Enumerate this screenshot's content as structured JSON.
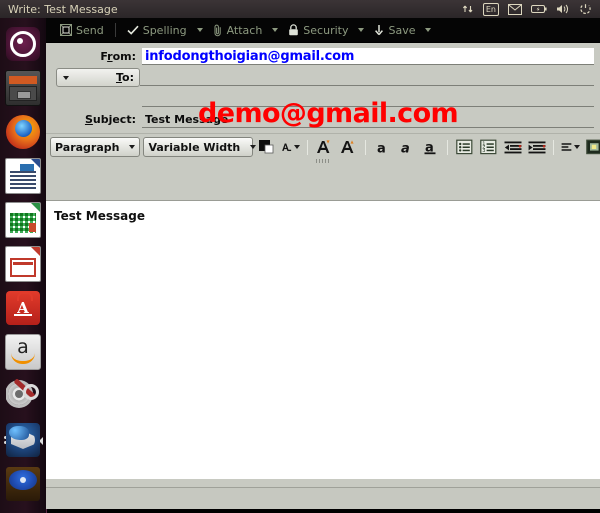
{
  "panel": {
    "title": "Write: Test Message",
    "indicators": [
      {
        "name": "network-icon",
        "label": "⇅"
      },
      {
        "name": "keyboard-layout-indicator",
        "label": "En"
      },
      {
        "name": "messaging-icon",
        "label": "✉"
      },
      {
        "name": "battery-icon",
        "label": ""
      },
      {
        "name": "volume-icon",
        "label": ""
      },
      {
        "name": "session-power-icon",
        "label": ""
      }
    ]
  },
  "launcher": {
    "items": [
      {
        "name": "launcher-ubuntu-dash",
        "label": "Dash home"
      },
      {
        "name": "launcher-files",
        "label": "Files"
      },
      {
        "name": "launcher-firefox",
        "label": "Firefox Web Browser"
      },
      {
        "name": "launcher-libreoffice-writer",
        "label": "LibreOffice Writer"
      },
      {
        "name": "launcher-libreoffice-calc",
        "label": "LibreOffice Calc"
      },
      {
        "name": "launcher-libreoffice-impress",
        "label": "LibreOffice Impress"
      },
      {
        "name": "launcher-software-center",
        "label": "Ubuntu Software Center"
      },
      {
        "name": "launcher-amazon",
        "label": "Amazon"
      },
      {
        "name": "launcher-system-settings",
        "label": "System Settings"
      },
      {
        "name": "launcher-thunderbird",
        "label": "Thunderbird Mail"
      },
      {
        "name": "launcher-media",
        "label": "Media player"
      }
    ]
  },
  "toolbar": {
    "send_label": "Send",
    "spelling_label": "Spelling",
    "attach_label": "Attach",
    "security_label": "Security",
    "save_label": "Save"
  },
  "headers": {
    "from_label": "From:",
    "from_value": "infodongthoigian@gmail.com",
    "to_label": "To:",
    "to_value": "demo@gmail.com",
    "subject_label": "Subject:",
    "subject_value": "Test Message"
  },
  "format_toolbar": {
    "paragraph_value": "Paragraph",
    "font_value": "Variable Width",
    "buttons": [
      {
        "name": "text-color-swatch",
        "label": "Text color"
      },
      {
        "name": "highlight-color-button",
        "label": "Highlight color"
      },
      {
        "name": "increase-font-size-button",
        "label": "Increase font size"
      },
      {
        "name": "decrease-font-size-button",
        "label": "Decrease font size"
      },
      {
        "name": "bold-button",
        "label": "Bold"
      },
      {
        "name": "italic-button",
        "label": "Italic"
      },
      {
        "name": "underline-button",
        "label": "Underline"
      },
      {
        "name": "bulleted-list-button",
        "label": "Bulleted list"
      },
      {
        "name": "numbered-list-button",
        "label": "Numbered list"
      },
      {
        "name": "decrease-indent-button",
        "label": "Decrease indent"
      },
      {
        "name": "increase-indent-button",
        "label": "Increase indent"
      },
      {
        "name": "align-button",
        "label": "Align"
      },
      {
        "name": "insert-button",
        "label": "Insert"
      }
    ]
  },
  "body": {
    "text": "Test Message"
  },
  "status": {
    "text": ""
  },
  "colors": {
    "from_text": "#0000ff",
    "to_text": "#ff0000",
    "window_bg": "#c8cac2",
    "toolbar_bg": "#050505",
    "toolbar_text": "#8d9a80"
  }
}
